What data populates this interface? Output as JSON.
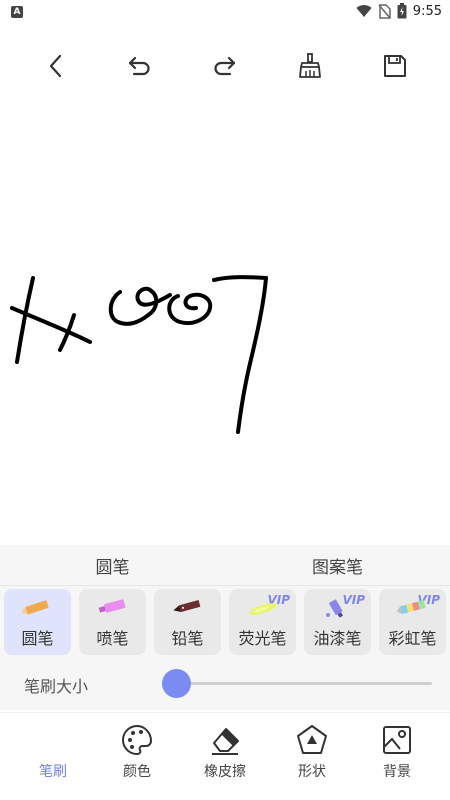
{
  "status_bar": {
    "left_icon": "A",
    "time": "9:55",
    "icons": [
      "wifi-icon",
      "no-sim-icon",
      "battery-charging-icon"
    ]
  },
  "toolbar": {
    "icons": [
      "back-icon",
      "undo-icon",
      "redo-icon",
      "clear-brush-icon",
      "save-icon"
    ]
  },
  "canvas": {
    "content": "hand-drawn black strokes"
  },
  "category_tabs": [
    {
      "label": "圆笔",
      "active": true
    },
    {
      "label": "图案笔",
      "active": false
    }
  ],
  "pens": [
    {
      "label": "圆笔",
      "selected": true,
      "vip": false,
      "color": "#f0a94f"
    },
    {
      "label": "喷笔",
      "selected": false,
      "vip": false,
      "color": "#e98ef0"
    },
    {
      "label": "铅笔",
      "selected": false,
      "vip": false,
      "color": "#6a3030"
    },
    {
      "label": "荧光笔",
      "selected": false,
      "vip": true,
      "color": "#e8f56a"
    },
    {
      "label": "油漆笔",
      "selected": false,
      "vip": true,
      "color": "#8b86e8"
    },
    {
      "label": "彩虹笔",
      "selected": false,
      "vip": true,
      "color": "#f08a8a"
    }
  ],
  "vip_label": "VIP",
  "brush_size": {
    "label": "笔刷大小",
    "value_fraction": 0.0
  },
  "bottom_nav": [
    {
      "label": "笔刷",
      "icon": "brush-icon",
      "active": true
    },
    {
      "label": "颜色",
      "icon": "palette-icon",
      "active": false
    },
    {
      "label": "橡皮擦",
      "icon": "eraser-icon",
      "active": false
    },
    {
      "label": "形状",
      "icon": "shape-icon",
      "active": false
    },
    {
      "label": "背景",
      "icon": "background-image-icon",
      "active": false
    }
  ],
  "colors": {
    "accent": "#7a8cf2",
    "selected_card": "#dfe3fb",
    "vip": "#7f86ee"
  }
}
